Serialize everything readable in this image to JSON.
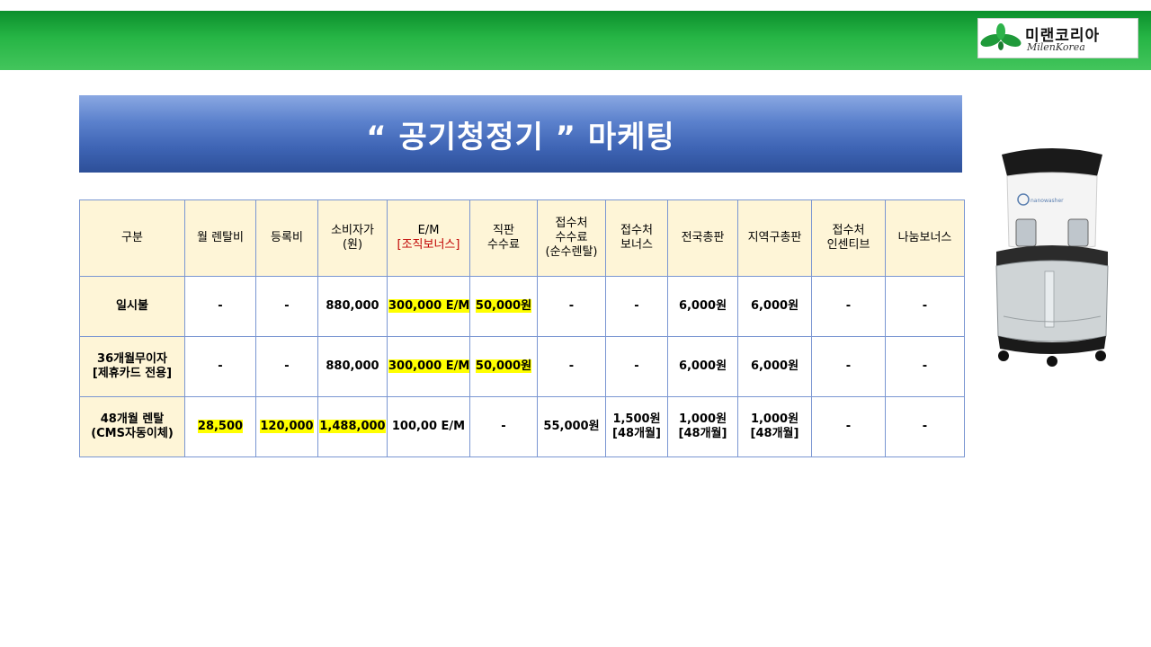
{
  "logo": {
    "text": "미랜코리아",
    "subtext": "MilenKorea"
  },
  "title": "“ 공기청정기 ” 마케팅",
  "table": {
    "headers": [
      {
        "lines": [
          "구분"
        ]
      },
      {
        "lines": [
          "월 렌탈비"
        ]
      },
      {
        "lines": [
          "등록비"
        ]
      },
      {
        "lines": [
          "소비자가",
          "(원)"
        ]
      },
      {
        "lines": [
          "E/M",
          "[조직보너스]"
        ]
      },
      {
        "lines": [
          "직판",
          "수수료"
        ]
      },
      {
        "lines": [
          "접수처",
          "수수료",
          "(순수렌탈)"
        ]
      },
      {
        "lines": [
          "접수처",
          "보너스"
        ]
      },
      {
        "lines": [
          "전국총판"
        ]
      },
      {
        "lines": [
          "지역구총판"
        ]
      },
      {
        "lines": [
          "접수처",
          "인센티브"
        ]
      },
      {
        "lines": [
          "나눔보너스"
        ]
      }
    ],
    "rows": [
      {
        "label": [
          "일시불"
        ],
        "cells": [
          {
            "lines": [
              "-"
            ]
          },
          {
            "lines": [
              "-"
            ]
          },
          {
            "lines": [
              "880,000"
            ]
          },
          {
            "lines": [
              "300,000 E/M"
            ],
            "highlight": true
          },
          {
            "lines": [
              "50,000원"
            ],
            "highlight": true
          },
          {
            "lines": [
              "-"
            ]
          },
          {
            "lines": [
              "-"
            ]
          },
          {
            "lines": [
              "6,000원"
            ]
          },
          {
            "lines": [
              "6,000원"
            ]
          },
          {
            "lines": [
              "-"
            ]
          },
          {
            "lines": [
              "-"
            ]
          }
        ]
      },
      {
        "label": [
          "36개월무이자",
          "[제휴카드 전용]"
        ],
        "cells": [
          {
            "lines": [
              "-"
            ]
          },
          {
            "lines": [
              "-"
            ]
          },
          {
            "lines": [
              "880,000"
            ]
          },
          {
            "lines": [
              "300,000 E/M"
            ],
            "highlight": true
          },
          {
            "lines": [
              "50,000원"
            ],
            "highlight": true
          },
          {
            "lines": [
              "-"
            ]
          },
          {
            "lines": [
              "-"
            ]
          },
          {
            "lines": [
              "6,000원"
            ]
          },
          {
            "lines": [
              "6,000원"
            ]
          },
          {
            "lines": [
              "-"
            ]
          },
          {
            "lines": [
              "-"
            ]
          }
        ]
      },
      {
        "label": [
          "48개월 렌탈",
          "(CMS자동이체)"
        ],
        "cells": [
          {
            "lines": [
              "28,500"
            ],
            "highlight": true
          },
          {
            "lines": [
              "120,000"
            ],
            "highlight": true
          },
          {
            "lines": [
              "1,488,000"
            ],
            "highlight": true
          },
          {
            "lines": [
              "100,00 E/M"
            ]
          },
          {
            "lines": [
              "-"
            ]
          },
          {
            "lines": [
              "55,000원"
            ]
          },
          {
            "lines": [
              "1,500원",
              "[48개월]"
            ]
          },
          {
            "lines": [
              "1,000원",
              "[48개월]"
            ]
          },
          {
            "lines": [
              "1,000원",
              "[48개월]"
            ]
          },
          {
            "lines": [
              "-"
            ]
          },
          {
            "lines": [
              "-"
            ]
          }
        ]
      }
    ]
  },
  "product_image": {
    "brand_text": "nanowasher"
  },
  "colors": {
    "top_band": "#26b545",
    "title_bar": "#3d63b3",
    "header_fill": "#fef5d7",
    "highlight": "#ffff00",
    "accent_red": "#c00000",
    "grid_line": "#7a96d2"
  }
}
